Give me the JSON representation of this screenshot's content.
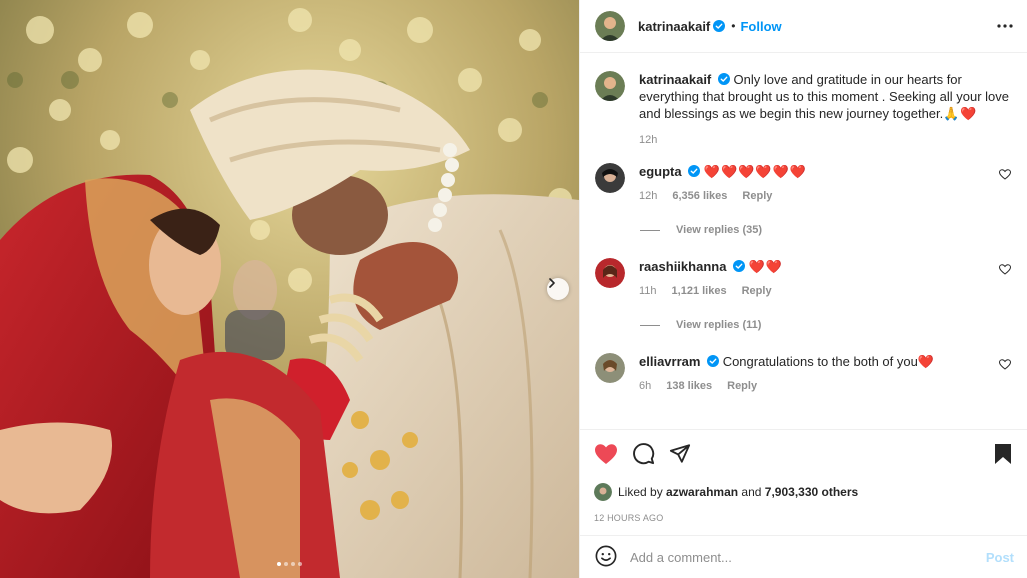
{
  "post": {
    "username": "katrinaakaif",
    "follow_label": "Follow",
    "separator": "•",
    "media_dots": 4,
    "active_dot": 0
  },
  "caption": {
    "username": "katrinaakaif",
    "text": "Only love and gratitude in our hearts for everything that brought us to this moment . Seeking all your love and blessings as we begin this new journey together.",
    "emoji": "🙏❤️",
    "time": "12h"
  },
  "comments": [
    {
      "username": "egupta",
      "text": "",
      "hearts": "❤️❤️❤️❤️❤️❤️",
      "time": "12h",
      "likes": "6,356 likes",
      "reply": "Reply",
      "view_replies": "View replies (35)"
    },
    {
      "username": "raashiikhanna",
      "text": "",
      "hearts": "❤️❤️",
      "time": "11h",
      "likes": "1,121 likes",
      "reply": "Reply",
      "view_replies": "View replies (11)"
    },
    {
      "username": "elliavrram",
      "text": "Congratulations to the both of you",
      "hearts": "❤️",
      "time": "6h",
      "likes": "138 likes",
      "reply": "Reply"
    }
  ],
  "likes": {
    "prefix": "Liked by",
    "user": "azwarahman",
    "middle": "and",
    "count": "7,903,330 others"
  },
  "timestamp": "12 HOURS AGO",
  "add_comment": {
    "placeholder": "Add a comment...",
    "post_label": "Post"
  },
  "colors": {
    "accent": "#0095f6",
    "heart": "#ed4956",
    "post_disabled": "#b2dffc",
    "muted": "#8e8e8e"
  }
}
